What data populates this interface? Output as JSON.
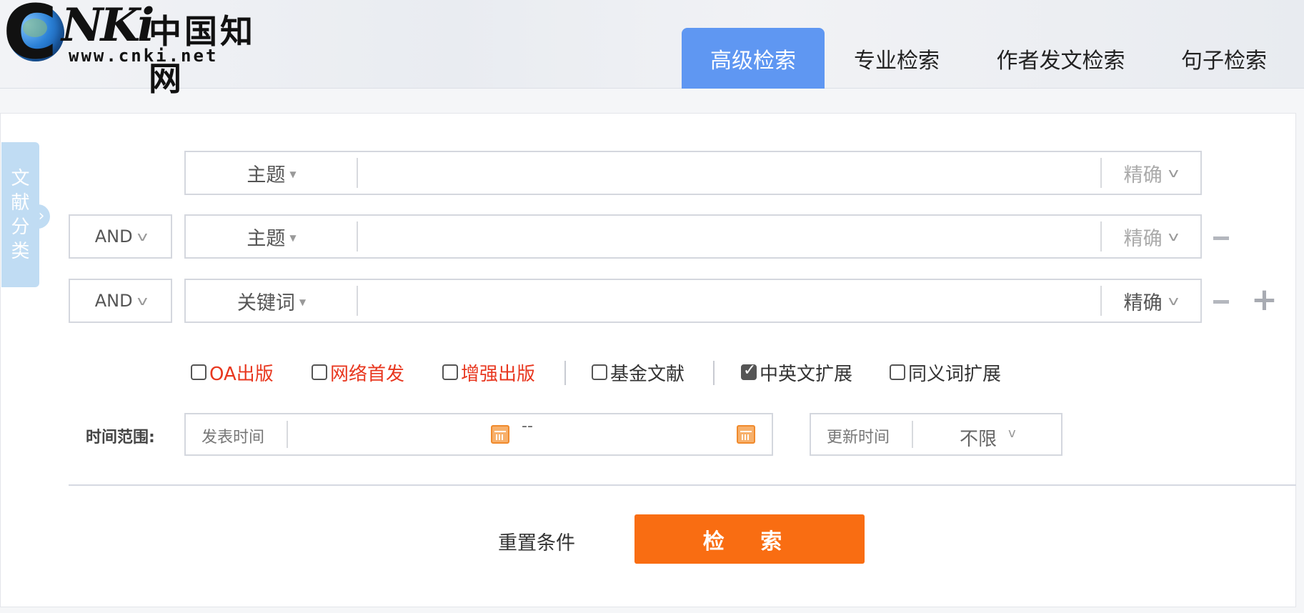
{
  "logo": {
    "brand_cn": "中国知网",
    "url": "www.cnki.net"
  },
  "tabs": [
    {
      "label": "高级检索",
      "active": true
    },
    {
      "label": "专业检索",
      "active": false
    },
    {
      "label": "作者发文检索",
      "active": false
    },
    {
      "label": "句子检索",
      "active": false
    }
  ],
  "sidebar_tab": {
    "chars": [
      "文",
      "献",
      "分",
      "类"
    ],
    "arrow": "›"
  },
  "rows": [
    {
      "logic": null,
      "field": "主题",
      "value": "",
      "match": "精确",
      "match_muted": true,
      "minus": false,
      "plus": false
    },
    {
      "logic": "AND",
      "field": "主题",
      "value": "",
      "match": "精确",
      "match_muted": true,
      "minus": true,
      "plus": false
    },
    {
      "logic": "AND",
      "field": "关键词",
      "value": "",
      "match": "精确",
      "match_muted": false,
      "minus": true,
      "plus": true
    }
  ],
  "chev": "v",
  "caret": "▼",
  "options": [
    {
      "label": "OA出版",
      "checked": false,
      "color": "#e8371f"
    },
    {
      "label": "网络首发",
      "checked": false,
      "color": "#e8371f"
    },
    {
      "label": "增强出版",
      "checked": false,
      "color": "#e8371f"
    },
    {
      "label": "基金文献",
      "checked": false,
      "color": "#333333"
    },
    {
      "label": "中英文扩展",
      "checked": true,
      "color": "#333333"
    },
    {
      "label": "同义词扩展",
      "checked": false,
      "color": "#333333"
    }
  ],
  "time": {
    "label": "时间范围:",
    "publish_label": "发表时间",
    "range_sep": "--",
    "update_label": "更新时间",
    "update_value": "不限"
  },
  "actions": {
    "reset": "重置条件",
    "search": "检 索"
  },
  "colors": {
    "accent_blue": "#5f97f2",
    "search_orange": "#f96d12",
    "red_option": "#e8371f"
  }
}
